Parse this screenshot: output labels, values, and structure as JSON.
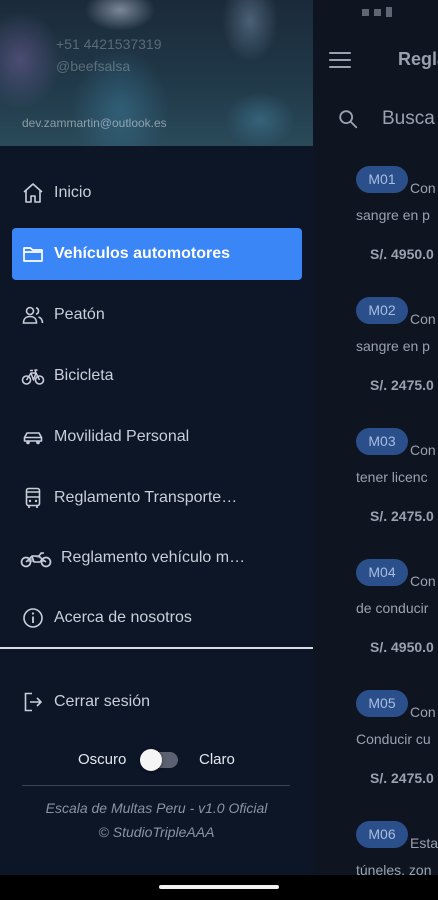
{
  "app": {
    "title": "Regla",
    "search_placeholder": "Busca",
    "fines": [
      {
        "code": "M01",
        "title": "Con",
        "desc": "sangre en p",
        "amount": "S/. 4950.0"
      },
      {
        "code": "M02",
        "title": "Con",
        "desc": "sangre en p",
        "amount": "S/. 2475.0"
      },
      {
        "code": "M03",
        "title": "Con",
        "desc": "tener licenc",
        "amount": "S/. 2475.0"
      },
      {
        "code": "M04",
        "title": "Con",
        "desc": "de conducir",
        "amount": "S/. 4950.0"
      },
      {
        "code": "M05",
        "title": "Con",
        "desc": "Conducir cu",
        "amount": "S/. 2475.0"
      },
      {
        "code": "M06",
        "title": "Esta",
        "desc": "túneles, zon",
        "amount": ""
      }
    ]
  },
  "drawer": {
    "header": {
      "line1": "+51 4421537319",
      "line2": "@beefsalsa",
      "email": "dev.zammartin@outlook.es"
    },
    "items": [
      {
        "label": "Inicio",
        "icon": "home-icon",
        "active": false
      },
      {
        "label": "Vehículos automotores",
        "icon": "folder-icon",
        "active": true
      },
      {
        "label": "Peatón",
        "icon": "people-icon",
        "active": false
      },
      {
        "label": "Bicicleta",
        "icon": "bicycle-icon",
        "active": false
      },
      {
        "label": "Movilidad Personal",
        "icon": "car-icon",
        "active": false
      },
      {
        "label": "Reglamento Transporte…",
        "icon": "bus-icon",
        "active": false
      },
      {
        "label": "Reglamento vehículo m…",
        "icon": "motorcycle-icon",
        "active": false
      },
      {
        "label": "Acerca de nosotros",
        "icon": "info-icon",
        "active": false
      }
    ],
    "logout_label": "Cerrar sesión",
    "theme": {
      "dark_label": "Oscuro",
      "light_label": "Claro",
      "is_light": false
    },
    "footer_line1": "Escala de Multas Peru - v1.0 Oficial",
    "footer_line2": "© StudioTripleAAA"
  },
  "colors": {
    "accent": "#3a86f7",
    "drawer_bg": "#0d1627",
    "chip_bg": "#2b4f8a"
  }
}
